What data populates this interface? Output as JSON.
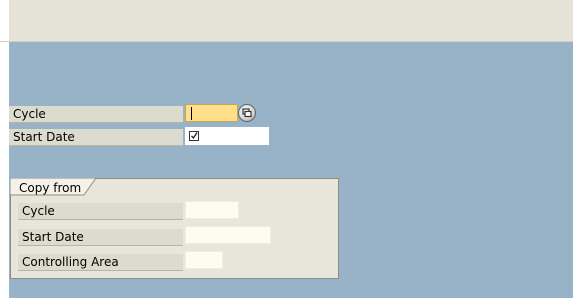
{
  "main_fields": {
    "cycle": {
      "label": "Cycle",
      "value": ""
    },
    "start_date": {
      "label": "Start Date",
      "value": ""
    }
  },
  "copy_from": {
    "title": "Copy from",
    "cycle": {
      "label": "Cycle",
      "value": ""
    },
    "start_date": {
      "label": "Start Date",
      "value": ""
    },
    "controlling_area": {
      "label": "Controlling Area",
      "value": ""
    }
  },
  "icons": {
    "value_help": "value-help-icon",
    "date_picker": "calendar-check-icon"
  },
  "colors": {
    "toolbar": "#e5e3d7",
    "workarea": "#98b3c7",
    "label_bg": "#dcdcce",
    "required_field": "#ffdf8a",
    "group_bg": "#e8e6da"
  }
}
